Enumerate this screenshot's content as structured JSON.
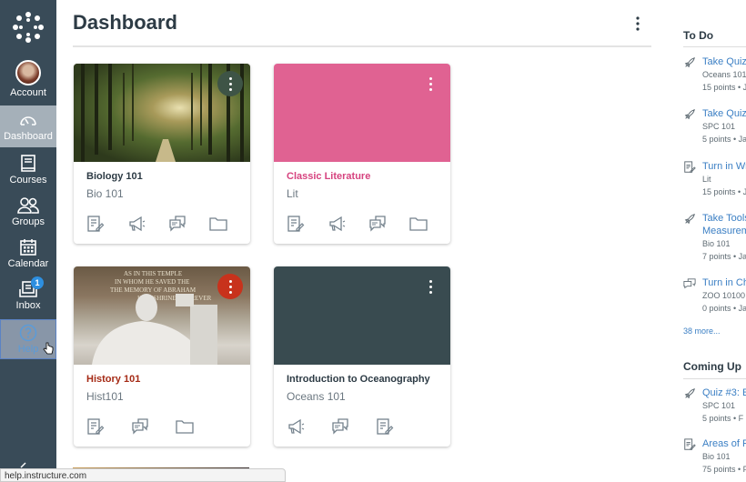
{
  "nav": {
    "account": "Account",
    "dashboard": "Dashboard",
    "courses": "Courses",
    "groups": "Groups",
    "calendar": "Calendar",
    "inbox": "Inbox",
    "inbox_badge": "1",
    "help": "Help"
  },
  "header": {
    "title": "Dashboard"
  },
  "cards": [
    {
      "title": "Biology 101",
      "code": "Bio 101",
      "color": "#2d3b45",
      "hero": "forest-photo",
      "menu_color": "#3e5446"
    },
    {
      "title": "Classic Literature",
      "code": "Lit",
      "color": "#d6437f",
      "hero_color": "#e06292"
    },
    {
      "title": "History 101",
      "code": "Hist101",
      "color": "#a52a15",
      "hero": "lincoln-memorial-photo",
      "menu_color": "#c8321c"
    },
    {
      "title": "Introduction to Oceanography",
      "code": "Oceans 101",
      "color": "#2d3b45",
      "hero_color": "#394b50"
    }
  ],
  "todo": {
    "heading": "To Do",
    "items": [
      {
        "icon": "rocket-icon",
        "title": "Take Quiz",
        "course": "Oceans 101",
        "meta": "15 points • J"
      },
      {
        "icon": "rocket-icon",
        "title": "Take Quiz",
        "course": "SPC 101",
        "meta": "5 points • Ja"
      },
      {
        "icon": "assignment-icon",
        "title": "Turn in Wr",
        "course": "Lit",
        "meta": "15 points • J"
      },
      {
        "icon": "rocket-icon",
        "title": "Take Tools",
        "title2": "Measurem",
        "course": "Bio 101",
        "meta": "7 points • Ja"
      },
      {
        "icon": "discussion-icon",
        "title": "Turn in Cha",
        "course": "ZOO 10100",
        "meta": "0 points • Ja"
      }
    ],
    "more": "38 more..."
  },
  "coming_up": {
    "heading": "Coming Up",
    "items": [
      {
        "icon": "rocket-icon",
        "title": "Quiz #3: E",
        "course": "SPC 101",
        "meta": "5 points • F"
      },
      {
        "icon": "assignment-icon",
        "title": "Areas of R",
        "course": "Bio 101",
        "meta": "75 points • F"
      }
    ]
  },
  "status_bar": {
    "url": "help.instructure.com"
  }
}
